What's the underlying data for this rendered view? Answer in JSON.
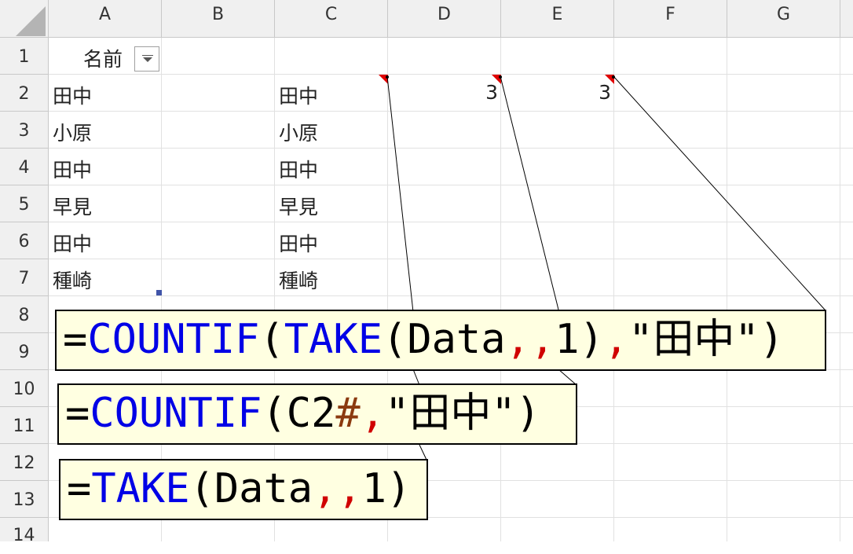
{
  "columns": [
    "A",
    "B",
    "C",
    "D",
    "E",
    "F",
    "G"
  ],
  "rows": [
    "1",
    "2",
    "3",
    "4",
    "5",
    "6",
    "7",
    "8",
    "9",
    "10",
    "11",
    "12",
    "13",
    "14"
  ],
  "cells": {
    "a1_header": "名前",
    "col_a": [
      "田中",
      "小原",
      "田中",
      "早見",
      "田中",
      "種崎"
    ],
    "col_c": [
      "田中",
      "小原",
      "田中",
      "早見",
      "田中",
      "種崎"
    ],
    "e2": "3",
    "f2": "3"
  },
  "formulas": {
    "f1": {
      "eq": "=",
      "fn": "COUNTIF",
      "p1": "(",
      "fn2": "TAKE",
      "p2": "(Data",
      "c1": ",",
      "c2": ",",
      "n": "1)",
      "c3": ",",
      "str": "\"田中\")"
    },
    "f2": {
      "eq": "=",
      "fn": "COUNTIF",
      "p1": "(C2",
      "hash": "#",
      "c1": ",",
      "str": "\"田中\")"
    },
    "f3": {
      "eq": "=",
      "fn": "TAKE",
      "p1": "(Data",
      "c1": ",",
      "c2": ",",
      "n": "1)"
    }
  },
  "colors": {
    "function_blue": "#0000e6",
    "separator_red": "#d00000",
    "spill_brown": "#8b3a0f",
    "comment_bg": "#ffffe1",
    "comment_indicator": "#e00000"
  }
}
